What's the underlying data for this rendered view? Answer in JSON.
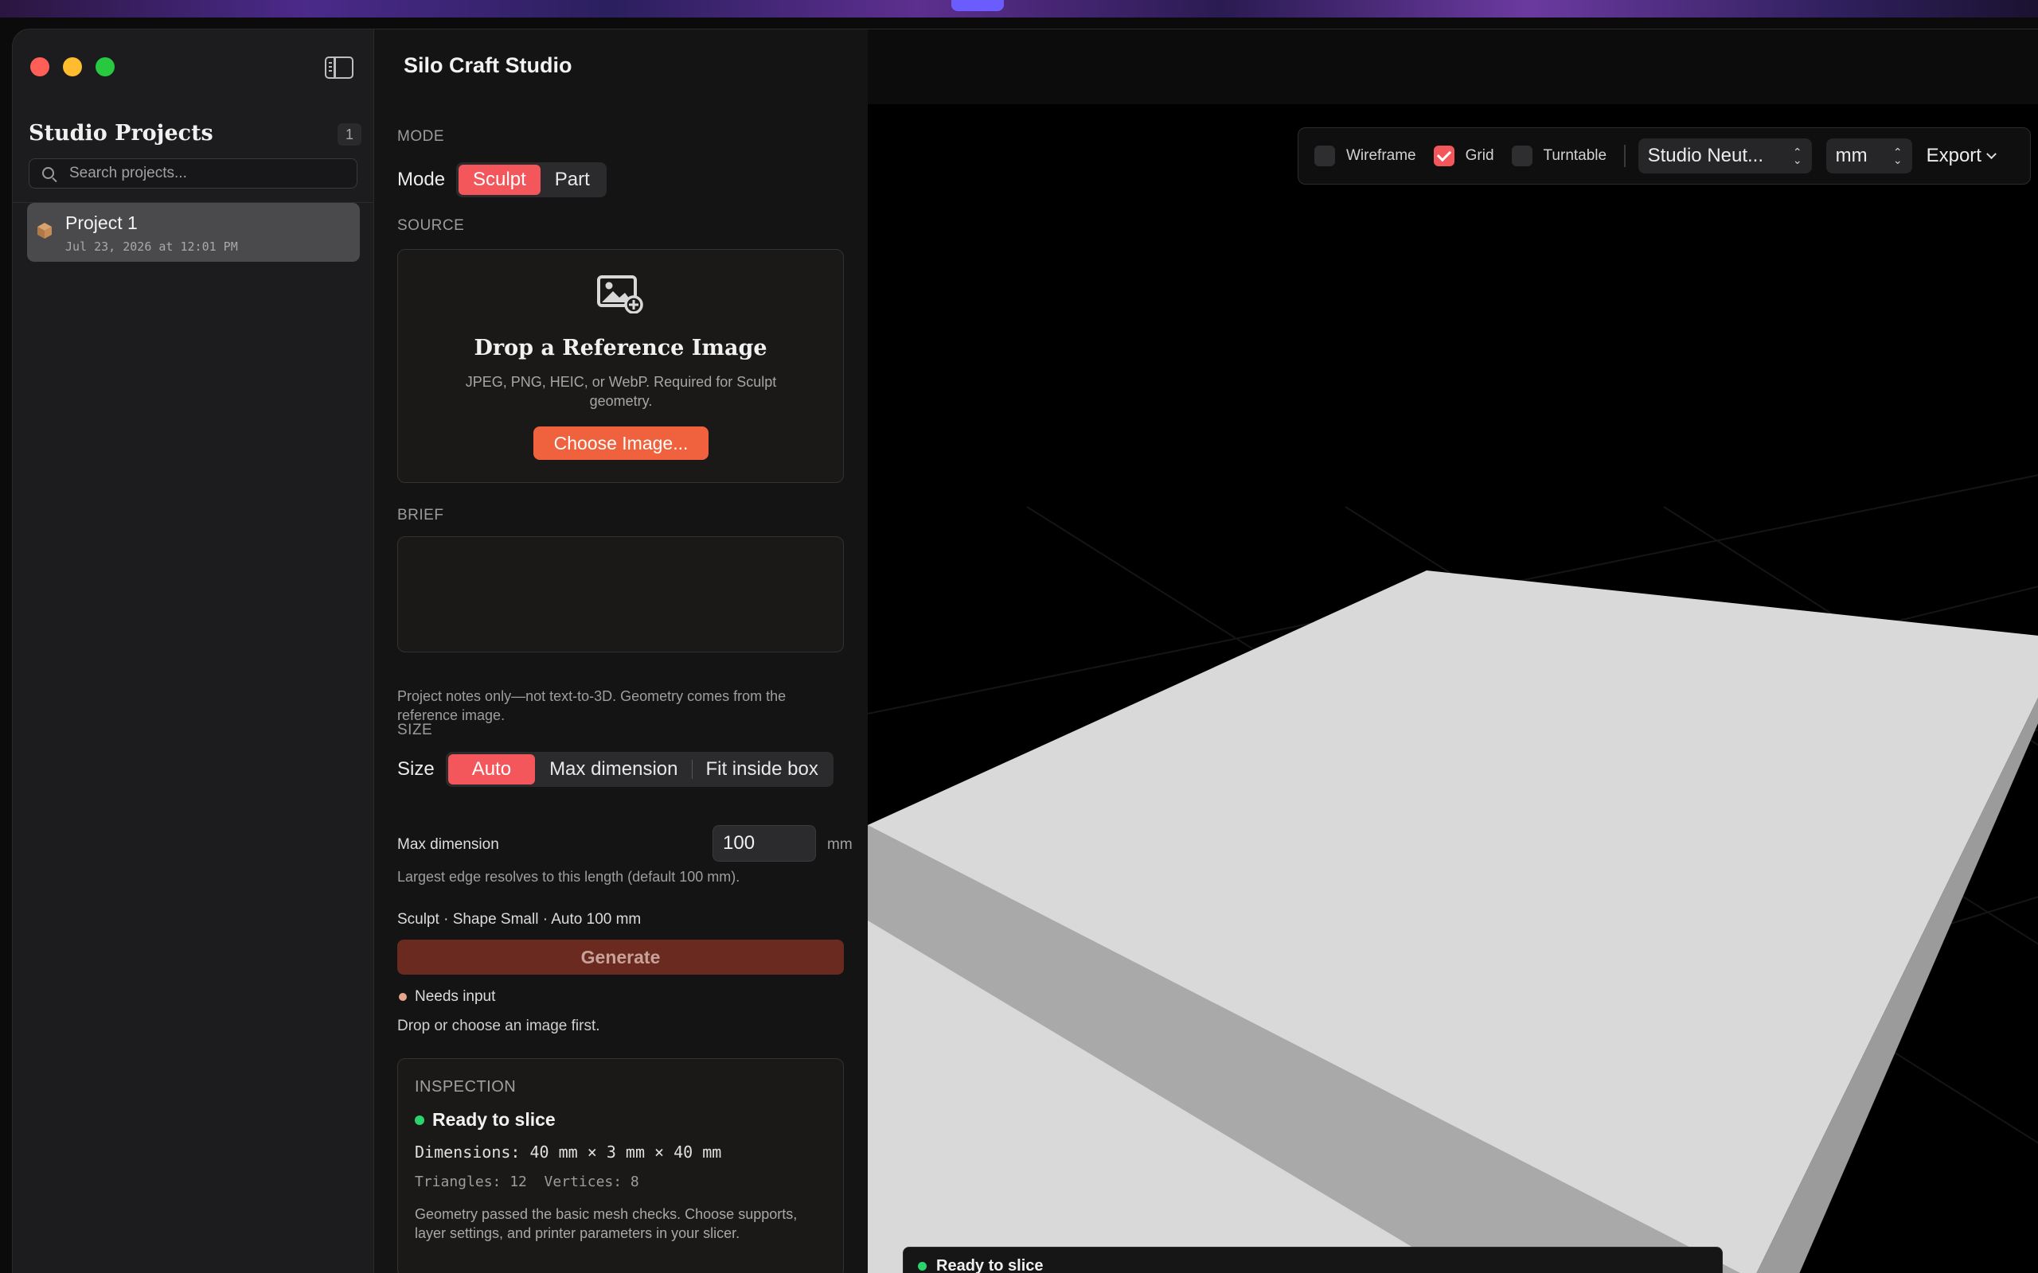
{
  "window": {
    "title": "Silo Craft Studio"
  },
  "sidebar": {
    "title": "Studio Projects",
    "count": "1",
    "search_placeholder": "Search projects...",
    "projects": [
      {
        "name": "Project 1",
        "date": "Jul 23, 2026 at 12:01 PM",
        "icon": "cube-icon"
      }
    ]
  },
  "panel": {
    "mode": {
      "section": "MODE",
      "label": "Mode",
      "options": [
        "Sculpt",
        "Part"
      ],
      "selected": "Sculpt"
    },
    "source": {
      "section": "SOURCE",
      "icon": "add-photo-icon",
      "title": "Drop a Reference Image",
      "subtitle": "JPEG, PNG, HEIC, or WebP. Required for Sculpt geometry.",
      "button": "Choose Image..."
    },
    "brief": {
      "section": "BRIEF",
      "value": "",
      "note": "Project notes only—not text-to-3D. Geometry comes from the reference image."
    },
    "size": {
      "section": "SIZE",
      "label": "Size",
      "options": [
        "Auto",
        "Max dimension",
        "Fit inside box"
      ],
      "selected": "Auto",
      "max_dimension_label": "Max dimension",
      "max_dimension_value": "100",
      "unit": "mm",
      "note": "Largest edge resolves to this length (default 100 mm)."
    },
    "summary": "Sculpt · Shape Small · Auto 100 mm",
    "generate_label": "Generate",
    "status": "Needs input",
    "hint": "Drop or choose an image first.",
    "inspection": {
      "heading": "INSPECTION",
      "status": "Ready to slice",
      "dimensions": "Dimensions: 40 mm × 3 mm × 40 mm",
      "counts": "Triangles: 12  Vertices: 8",
      "description": "Geometry passed the basic mesh checks. Choose supports, layer settings, and printer parameters in your slicer."
    }
  },
  "viewport": {
    "toggles": [
      {
        "label": "Wireframe",
        "checked": false
      },
      {
        "label": "Grid",
        "checked": true
      },
      {
        "label": "Turntable",
        "checked": false
      }
    ],
    "environment": "Studio Neut...",
    "units": "mm",
    "export_label": "Export",
    "bottom_status": "Ready to slice"
  },
  "colors": {
    "accent": "#f4575b",
    "choose_button": "#f0623d",
    "generate_disabled": "#6b2a1f",
    "ready": "#2bd36b",
    "needs_input": "#e8a48f"
  }
}
